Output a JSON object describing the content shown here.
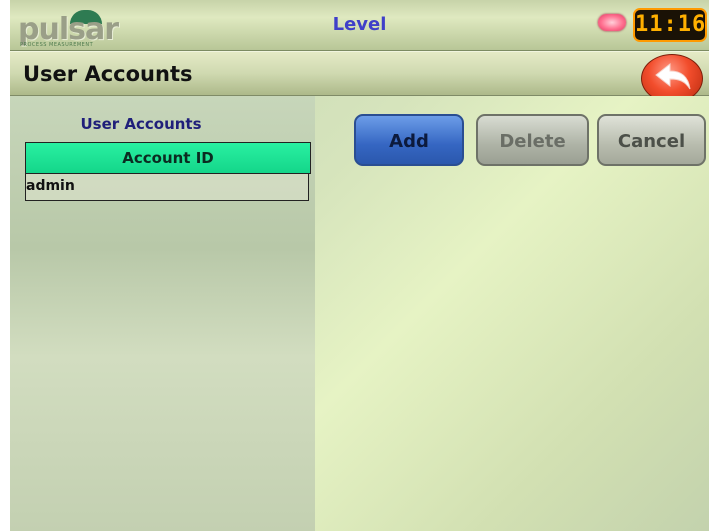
{
  "app": {
    "logo_text": "pulsar",
    "logo_subtext": "PROCESS MEASUREMENT",
    "title": "Level",
    "clock": "11:16"
  },
  "header": {
    "page_title": "User Accounts"
  },
  "accounts_panel": {
    "heading": "User Accounts",
    "column_header": "Account ID",
    "rows": [
      "admin"
    ]
  },
  "actions": {
    "add_label": "Add",
    "delete_label": "Delete",
    "cancel_label": "Cancel"
  },
  "colors": {
    "accent_blue": "#3566c2",
    "table_header": "#14d68a",
    "back_button": "#f24d2c",
    "clock_text": "#ffb000"
  }
}
